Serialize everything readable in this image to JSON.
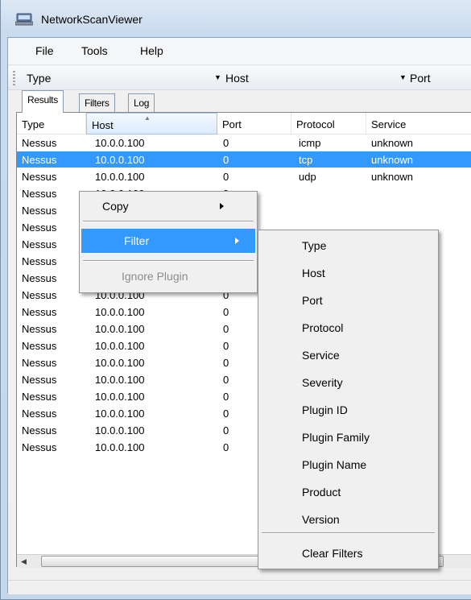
{
  "window": {
    "title": "NetworkScanViewer"
  },
  "menu": [
    "File",
    "Tools",
    "Help"
  ],
  "toolbar": {
    "type_label": "Type",
    "host_label": "Host",
    "port_label": "Port"
  },
  "tabs": [
    "Results",
    "Filters",
    "Log"
  ],
  "list": {
    "columns": [
      "Type",
      "Host",
      "Port",
      "Protocol",
      "Service"
    ],
    "rows": [
      [
        "Nessus",
        "10.0.0.100",
        "0",
        "icmp",
        "unknown"
      ],
      [
        "Nessus",
        "10.0.0.100",
        "0",
        "tcp",
        "unknown"
      ],
      [
        "Nessus",
        "10.0.0.100",
        "0",
        "udp",
        "unknown"
      ],
      [
        "Nessus",
        "10.0.0.100",
        "0",
        "",
        ""
      ],
      [
        "Nessus",
        "10.0.0.100",
        "0",
        "",
        ""
      ],
      [
        "Nessus",
        "10.0.0.100",
        "0",
        "",
        ""
      ],
      [
        "Nessus",
        "10.0.0.100",
        "0",
        "",
        ""
      ],
      [
        "Nessus",
        "10.0.0.100",
        "0",
        "",
        ""
      ],
      [
        "Nessus",
        "10.0.0.100",
        "0",
        "",
        ""
      ],
      [
        "Nessus",
        "10.0.0.100",
        "0",
        "",
        ""
      ],
      [
        "Nessus",
        "10.0.0.100",
        "0",
        "",
        ""
      ],
      [
        "Nessus",
        "10.0.0.100",
        "0",
        "",
        ""
      ],
      [
        "Nessus",
        "10.0.0.100",
        "0",
        "",
        ""
      ],
      [
        "Nessus",
        "10.0.0.100",
        "0",
        "",
        ""
      ],
      [
        "Nessus",
        "10.0.0.100",
        "0",
        "",
        ""
      ],
      [
        "Nessus",
        "10.0.0.100",
        "0",
        "",
        ""
      ],
      [
        "Nessus",
        "10.0.0.100",
        "0",
        "",
        ""
      ],
      [
        "Nessus",
        "10.0.0.100",
        "0",
        "",
        ""
      ],
      [
        "Nessus",
        "10.0.0.100",
        "0",
        "",
        ""
      ]
    ],
    "selected_index": 1
  },
  "context_menu": {
    "items": [
      "Copy",
      "Filter",
      "Ignore Plugin"
    ],
    "highlighted": "Filter",
    "disabled": "Ignore Plugin"
  },
  "filter_submenu": {
    "items": [
      "Type",
      "Host",
      "Port",
      "Protocol",
      "Service",
      "Severity",
      "Plugin ID",
      "Plugin Family",
      "Plugin Name",
      "Product",
      "Version"
    ],
    "clear": "Clear Filters"
  },
  "colors": {
    "selection": "#3399ff",
    "title_bar": "#c9dbee"
  }
}
